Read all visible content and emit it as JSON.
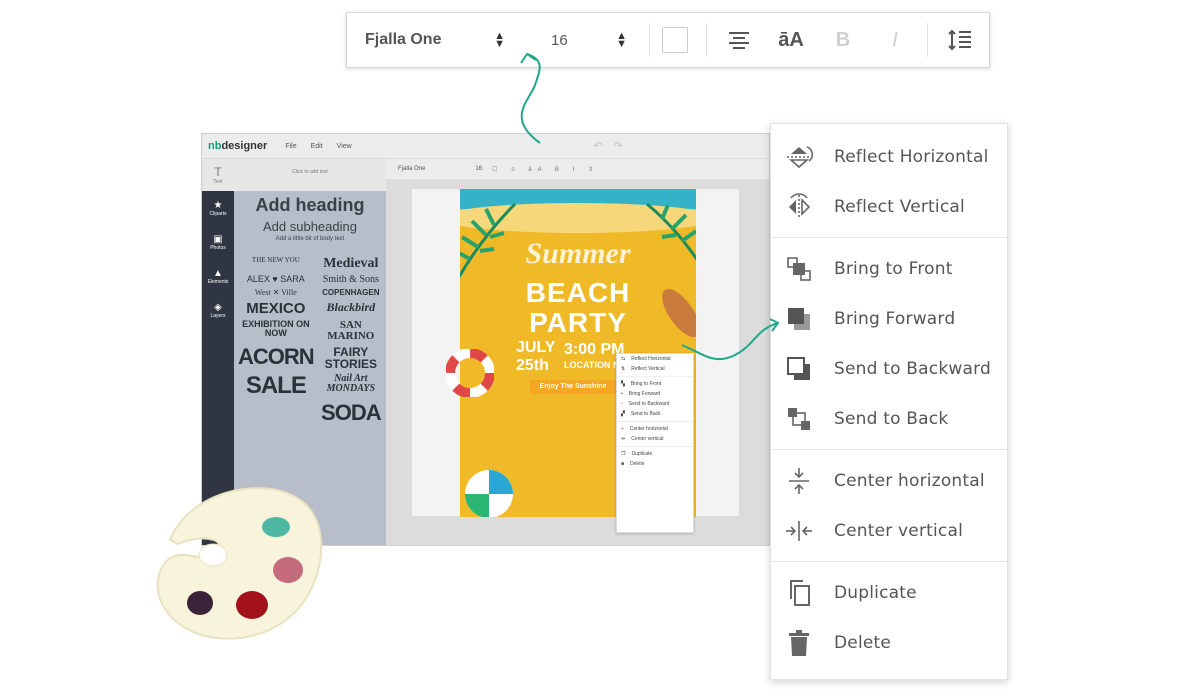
{
  "toolbar": {
    "font_name": "Fjalla One",
    "font_size": "16",
    "align_icon": "align-center-icon",
    "case_label": "āA",
    "bold_label": "B",
    "italic_label": "I",
    "line_height_icon": "line-height-icon"
  },
  "app": {
    "logo_prefix": "nb",
    "logo_suffix": "designer",
    "menu": [
      "File",
      "Edit",
      "View"
    ],
    "sidebar": [
      {
        "icon": "text-icon",
        "label": "Text"
      },
      {
        "icon": "star-icon",
        "label": "Cliparts"
      },
      {
        "icon": "photo-icon",
        "label": "Photos"
      },
      {
        "icon": "shapes-icon",
        "label": "Elements"
      },
      {
        "icon": "layers-icon",
        "label": "Layers"
      }
    ],
    "panel": {
      "hint": "Click to add text",
      "heading": "Add heading",
      "subheading": "Add subheading",
      "body": "Add a little bit of body text"
    },
    "font_samples": [
      "THE NEW YOU",
      "Medieval",
      "ALEX ♥ SARA",
      "Smith & Sons",
      "West ✕ Ville",
      "COPENHAGEN",
      "MEXICO",
      "Blackbird",
      "EXHIBITION ON NOW",
      "SAN MARINO",
      "ACORN",
      "FAIRY STORIES",
      "SALE",
      "Nail Art MONDAYS",
      "",
      "SODA"
    ],
    "mini_toolbar": {
      "font": "Fjalla One",
      "size": "16"
    },
    "poster": {
      "title1": "Summer",
      "title2": "BEACH",
      "title3": "PARTY",
      "date_line1": "JULY",
      "date_line2": "25th",
      "time": "3:00 PM",
      "location": "LOCATION NA",
      "tagline": "Enjoy The Sunshine"
    },
    "mini_menu": [
      "Reflect Horizontal",
      "Reflect Vertical",
      "Bring to Front",
      "Bring Forward",
      "Send to Backward",
      "Send to Back",
      "Center horizontal",
      "Center vertical",
      "Duplicate",
      "Delete"
    ]
  },
  "context_menu": {
    "groups": [
      [
        {
          "label": "Reflect Horizontal",
          "icon": "reflect-horizontal-icon"
        },
        {
          "label": "Reflect Vertical",
          "icon": "reflect-vertical-icon"
        }
      ],
      [
        {
          "label": "Bring to Front",
          "icon": "bring-to-front-icon"
        },
        {
          "label": "Bring Forward",
          "icon": "bring-forward-icon"
        },
        {
          "label": "Send to Backward",
          "icon": "send-backward-icon"
        },
        {
          "label": "Send to Back",
          "icon": "send-to-back-icon"
        }
      ],
      [
        {
          "label": "Center horizontal",
          "icon": "center-horizontal-icon"
        },
        {
          "label": "Center vertical",
          "icon": "center-vertical-icon"
        }
      ],
      [
        {
          "label": "Duplicate",
          "icon": "duplicate-icon"
        },
        {
          "label": "Delete",
          "icon": "delete-icon"
        }
      ]
    ]
  },
  "colors": {
    "accent": "#1c9a82",
    "arrow": "#1fa88a",
    "poster_yellow": "#f0b928",
    "rail_dark": "#2f3542",
    "panel_grey": "#b7bec9"
  }
}
